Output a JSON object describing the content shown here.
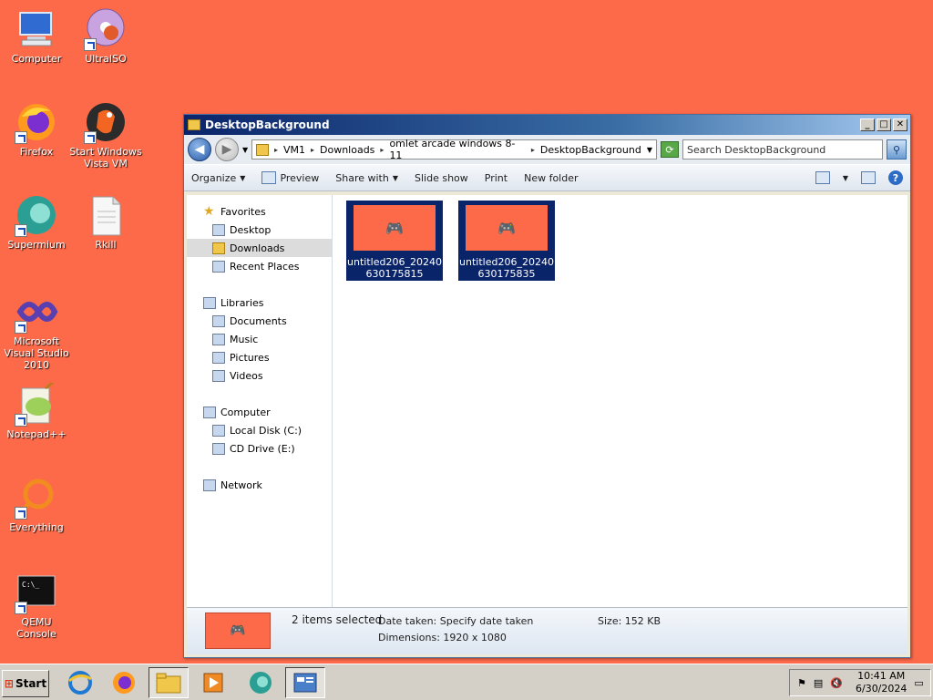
{
  "desktop": {
    "icons": [
      {
        "label": "Computer"
      },
      {
        "label": "UltraISO"
      },
      {
        "label": "Firefox"
      },
      {
        "label": "Start Windows Vista VM"
      },
      {
        "label": "Supermium"
      },
      {
        "label": "Rkill"
      },
      {
        "label": "Microsoft Visual Studio 2010"
      },
      {
        "label": "Notepad++"
      },
      {
        "label": "Everything"
      },
      {
        "label": "QEMU Console"
      }
    ]
  },
  "window": {
    "title": "DesktopBackground",
    "address": {
      "crumbs": [
        "VM1",
        "Downloads",
        "omlet arcade windows 8-11",
        "DesktopBackground"
      ]
    },
    "search_placeholder": "Search DesktopBackground",
    "toolbar": {
      "organize": "Organize",
      "preview": "Preview",
      "share_with": "Share with",
      "slide_show": "Slide show",
      "print": "Print",
      "new_folder": "New folder"
    },
    "nav": {
      "favorites": "Favorites",
      "desktop": "Desktop",
      "downloads": "Downloads",
      "recent_places": "Recent Places",
      "libraries": "Libraries",
      "documents": "Documents",
      "music": "Music",
      "pictures": "Pictures",
      "videos": "Videos",
      "computer": "Computer",
      "local_disk": "Local Disk (C:)",
      "cd_drive": "CD Drive (E:)",
      "network": "Network"
    },
    "files": [
      {
        "line1": "untitled206_20240",
        "line2": "630175815"
      },
      {
        "line1": "untitled206_20240",
        "line2": "630175835"
      }
    ],
    "details": {
      "selected": "2 items selected",
      "date_taken": "Date taken: Specify date taken",
      "dimensions": "Dimensions: 1920 x 1080",
      "size": "Size:  152 KB"
    }
  },
  "taskbar": {
    "start_label": "Start",
    "clock_time": "10:41 AM",
    "clock_date": "6/30/2024"
  },
  "colors": {
    "desktop_bg": "#fd6a4a",
    "selection": "#0a246a"
  }
}
